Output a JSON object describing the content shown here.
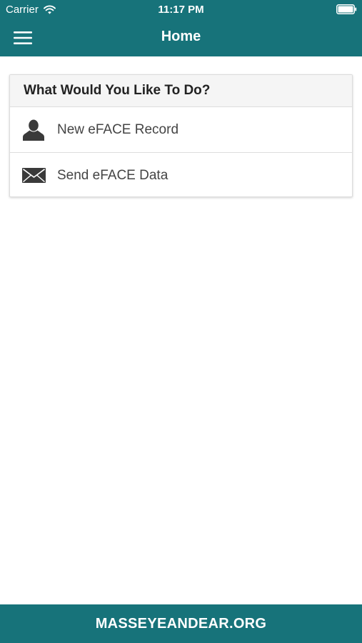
{
  "colors": {
    "brand": "#17737a",
    "header_bg": "#f5f5f5",
    "text_dark": "#222222",
    "text_item": "#444444"
  },
  "status_bar": {
    "carrier": "Carrier",
    "time": "11:17 PM",
    "icons": [
      "wifi-icon",
      "battery-icon"
    ]
  },
  "nav": {
    "title": "Home",
    "menu_icon": "hamburger-menu-icon"
  },
  "actions_card": {
    "heading": "What Would You Like To Do?",
    "items": [
      {
        "label": "New eFACE Record",
        "icon": "person-icon"
      },
      {
        "label": "Send eFACE Data",
        "icon": "envelope-icon"
      }
    ]
  },
  "footer": {
    "text": "MASSEYEANDEAR.ORG"
  }
}
